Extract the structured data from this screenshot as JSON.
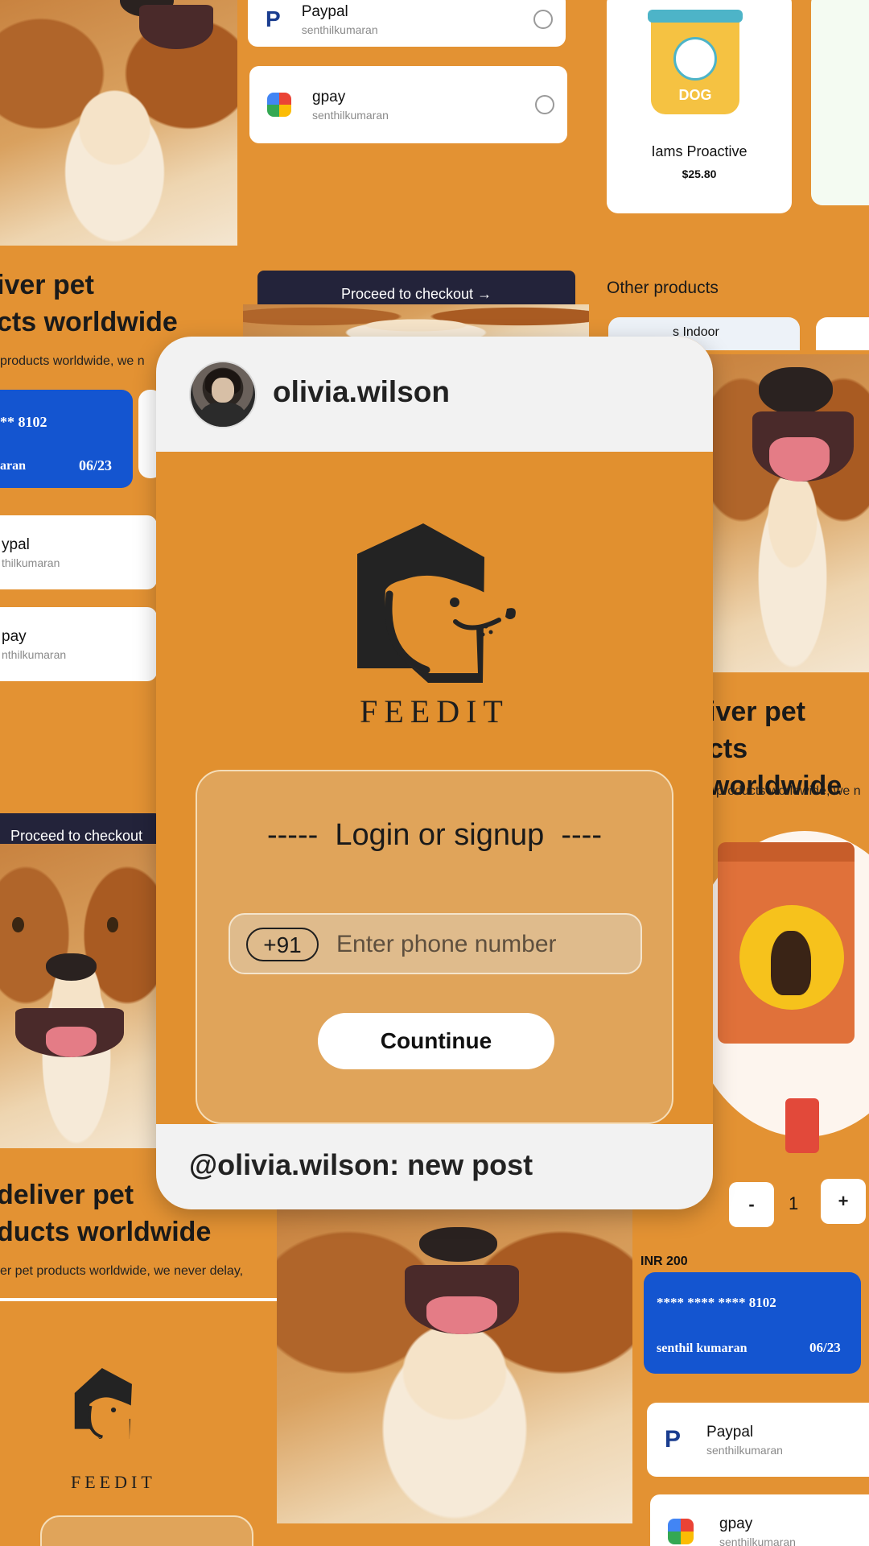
{
  "post": {
    "username": "olivia.wilson",
    "caption": "@olivia.wilson: new post"
  },
  "app": {
    "brand": "FEEDIT",
    "login_title": "-----  Login or signup  ----",
    "country_code": "+91",
    "phone_placeholder": "Enter phone number",
    "continue_label": "Countinue"
  },
  "background": {
    "payment_top": [
      {
        "name": "Paypal",
        "sub": "senthilkumaran"
      },
      {
        "name": "gpay",
        "sub": "senthilkumaran"
      }
    ],
    "checkout_label": "Proceed to checkout",
    "product": {
      "name": "Iams Proactive",
      "price": "$25.80"
    },
    "other_products_label": "Other products",
    "other_product_partial": "s Indoor",
    "heading_line1": "iver pet",
    "heading_line2": "cts worldwide",
    "subtext": "products worldwide, we n",
    "card_left_number": "** 8102",
    "card_left_name": "aran",
    "card_left_expiry": "06/23",
    "pay_left": [
      {
        "name": "ypal",
        "sub": "thilkumaran"
      },
      {
        "name": "pay",
        "sub": "nthilkumaran"
      }
    ],
    "checkout_left": "Proceed to checkout",
    "heading_right_line1": "iver pet",
    "heading_right_line2": "cts worldwide",
    "subtext_right": "products worldwide, we n",
    "qty_minus": "-",
    "qty_value": "1",
    "qty_plus": "+",
    "heading_bottom_line1": "deliver pet",
    "heading_bottom_line2": "ducts worldwide",
    "subtext_bottom": "er pet products worldwide, we never delay,",
    "inr_label": "INR 200",
    "card_right_number": "**** **** **** 8102",
    "card_right_name": "senthil kumaran",
    "card_right_expiry": "06/23",
    "pay_bottom": [
      {
        "name": "Paypal",
        "sub": "senthilkumaran"
      },
      {
        "name": "gpay",
        "sub": "senthilkumaran"
      }
    ],
    "brand_small": "FEEDIT"
  },
  "colors": {
    "background": "#e39233",
    "panel": "#e0a45a",
    "card_blue": "#1455d0",
    "dark_button": "#23233a"
  }
}
